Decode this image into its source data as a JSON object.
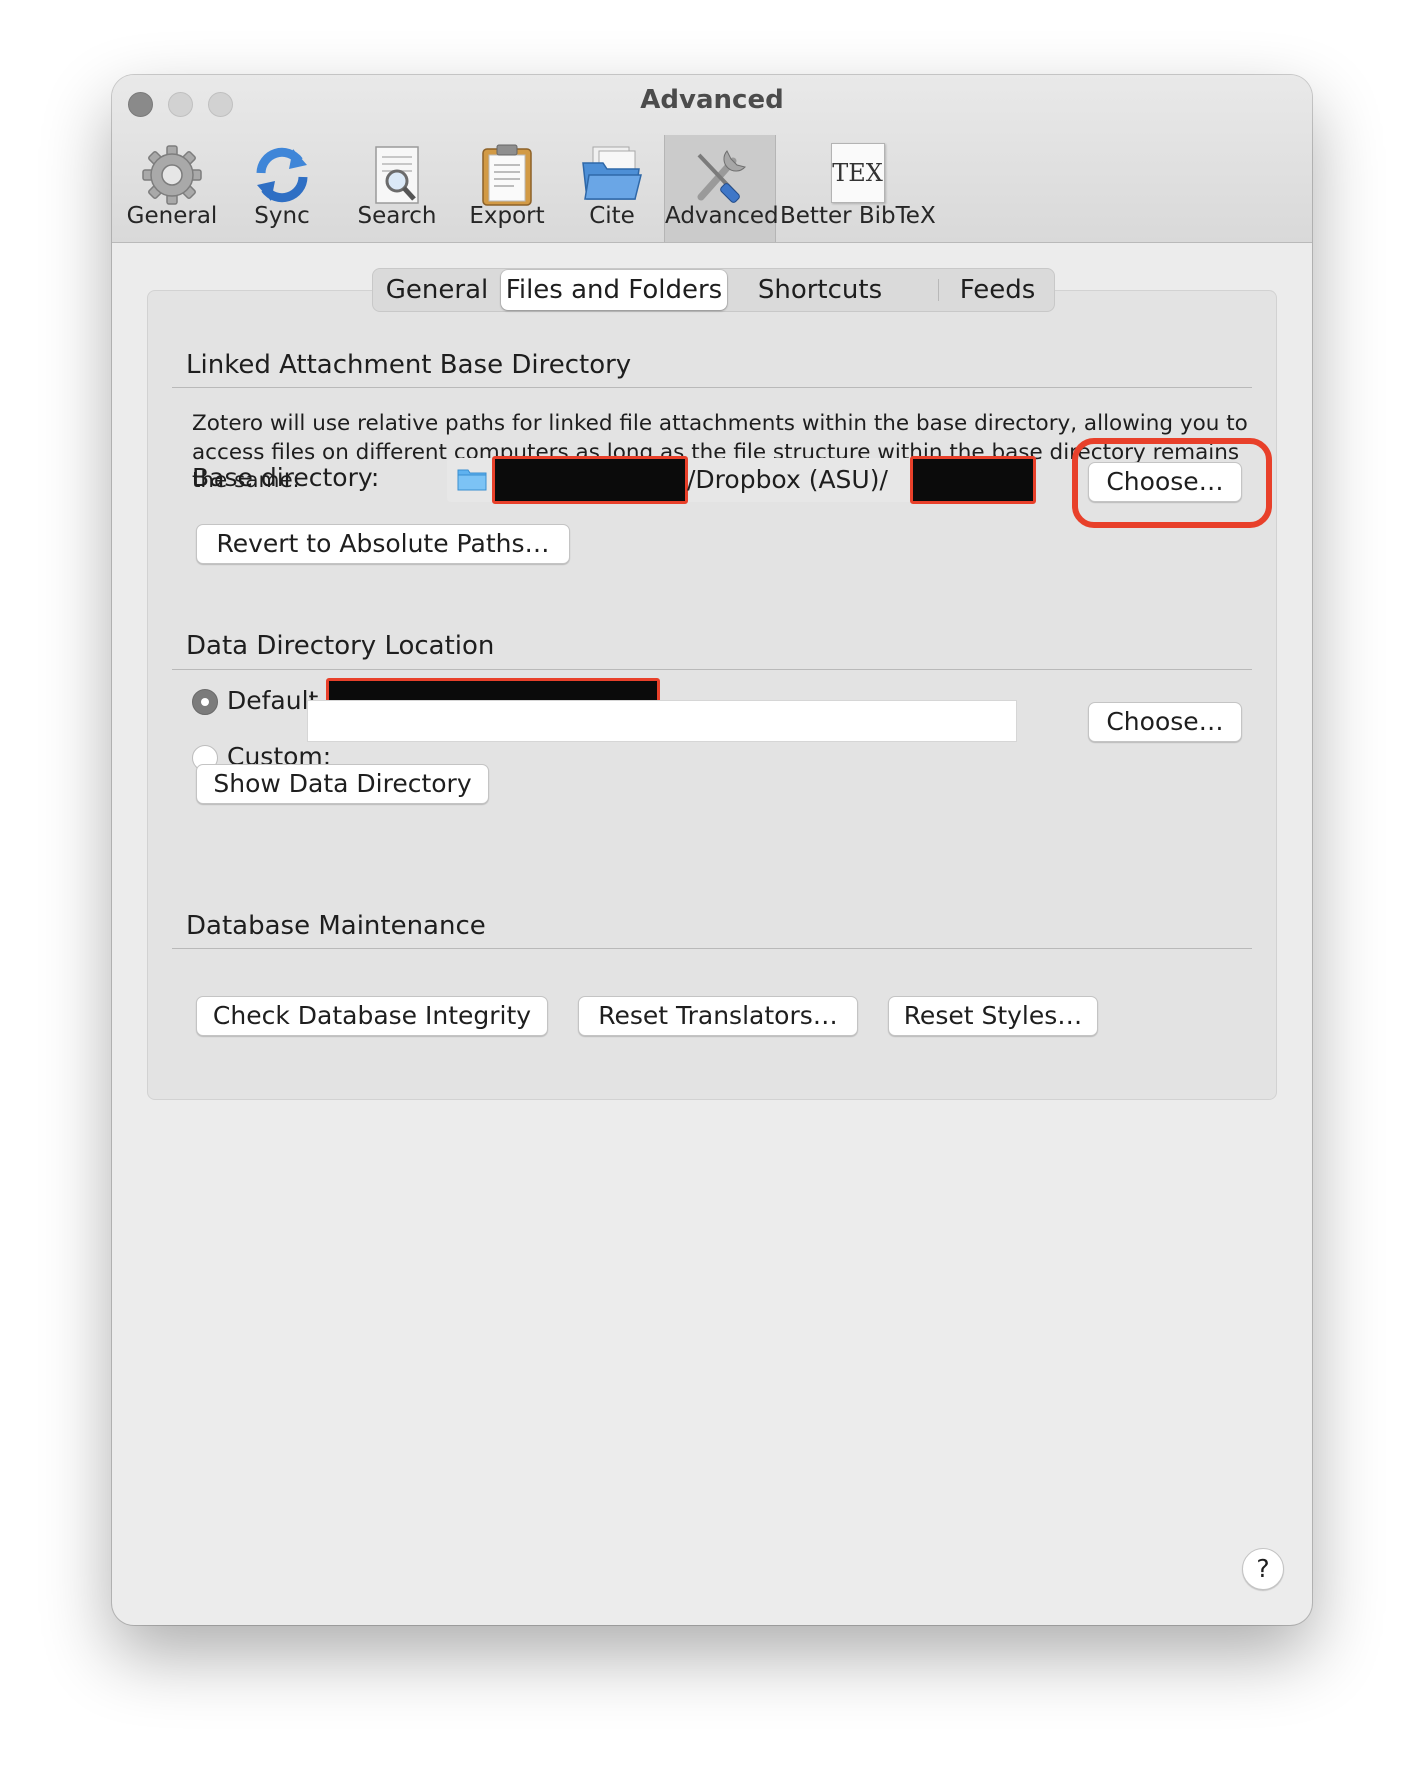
{
  "window": {
    "title": "Advanced"
  },
  "toolbar": {
    "items": [
      {
        "label": "General",
        "icon": "gear-icon"
      },
      {
        "label": "Sync",
        "icon": "sync-icon"
      },
      {
        "label": "Search",
        "icon": "search-icon"
      },
      {
        "label": "Export",
        "icon": "clipboard-icon"
      },
      {
        "label": "Cite",
        "icon": "folder-icon"
      },
      {
        "label": "Advanced",
        "icon": "tools-icon",
        "active": true
      },
      {
        "label": "Better BibTeX",
        "icon": "tex-icon",
        "icon_text": "TEX"
      }
    ]
  },
  "tabs": [
    {
      "label": "General"
    },
    {
      "label": "Files and Folders",
      "selected": true
    },
    {
      "label": "Shortcuts"
    },
    {
      "label": "Feeds"
    }
  ],
  "linked_attachment": {
    "title": "Linked Attachment Base Directory",
    "description": "Zotero will use relative paths for linked file attachments within the base directory, allowing you to access files on different computers as long as the file structure within the base directory remains the same.",
    "base_directory_label": "Base directory:",
    "path_middle": "/Dropbox (ASU)/",
    "choose_label": "Choose…",
    "revert_label": "Revert to Absolute Paths…"
  },
  "data_directory": {
    "title": "Data Directory Location",
    "default_label": "Default",
    "custom_label": "Custom:",
    "custom_value": "",
    "choose_label": "Choose…",
    "show_label": "Show Data Directory",
    "selected_option": "Default"
  },
  "database_maintenance": {
    "title": "Database Maintenance",
    "check_label": "Check Database Integrity",
    "reset_translators_label": "Reset Translators…",
    "reset_styles_label": "Reset Styles…"
  },
  "help": {
    "label": "?"
  },
  "colors": {
    "annotation_red": "#e8402a",
    "redaction": "#0b0b0b",
    "window_bg": "#ececec"
  }
}
